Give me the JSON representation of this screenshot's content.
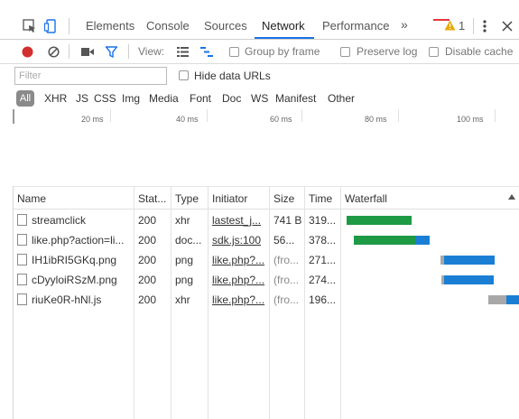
{
  "tabs": {
    "items": [
      {
        "label": "Elements"
      },
      {
        "label": "Console"
      },
      {
        "label": "Sources"
      },
      {
        "label": "Network"
      },
      {
        "label": "Performance"
      }
    ],
    "overflow": "»",
    "warning_count": "1",
    "active": "Network"
  },
  "toolbar": {
    "view_label": "View:",
    "group_by_frame": "Group by frame",
    "preserve_log": "Preserve log",
    "disable_cache": "Disable cache"
  },
  "filter": {
    "placeholder": "Filter",
    "value": "",
    "hide_data_urls": "Hide data URLs"
  },
  "type_filters": {
    "all": "All",
    "items": [
      "XHR",
      "JS",
      "CSS",
      "Img",
      "Media",
      "Font",
      "Doc",
      "WS",
      "Manifest",
      "Other"
    ]
  },
  "overview": {
    "labels": [
      "20 ms",
      "40 ms",
      "60 ms",
      "80 ms",
      "100 ms"
    ]
  },
  "table": {
    "columns": [
      "Name",
      "Stat...",
      "Type",
      "Initiator",
      "Size",
      "Time",
      "Waterfall"
    ],
    "rows": [
      {
        "name": "streamclick",
        "status": "200",
        "type": "xhr",
        "initiator": "lastest_j...",
        "size": "741 B",
        "time": "319..."
      },
      {
        "name": "like.php?action=li...",
        "status": "200",
        "type": "doc...",
        "initiator": "sdk.js:100",
        "size": "56...",
        "time": "378..."
      },
      {
        "name": "IH1ibRI5GKq.png",
        "status": "200",
        "type": "png",
        "initiator": "like.php?...",
        "size": "(fro...",
        "time": "271..."
      },
      {
        "name": "cDyyloiRSzM.png",
        "status": "200",
        "type": "png",
        "initiator": "like.php?...",
        "size": "(fro...",
        "time": "274..."
      },
      {
        "name": "riuKe0R-hNl.js",
        "status": "200",
        "type": "xhr",
        "initiator": "like.php?...",
        "size": "(fro...",
        "time": "196..."
      }
    ]
  },
  "colors": {
    "accent": "#1a73e8",
    "record": "#d32f2f",
    "waterfall_green": "#1e9a45",
    "waterfall_blue": "#1a7fd4",
    "waterfall_gray": "#a8a8a8",
    "warning": "#e8a800"
  }
}
